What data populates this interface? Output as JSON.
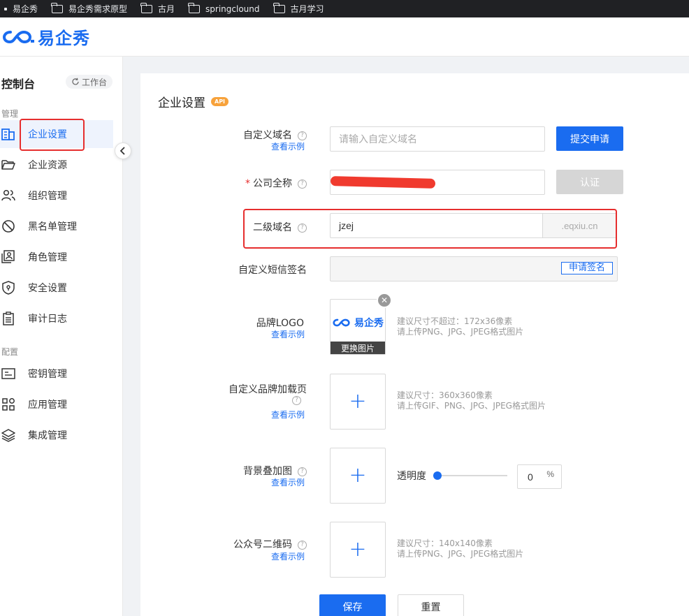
{
  "bookmarks": [
    {
      "label": "易企秀",
      "icon": "dot-icon"
    },
    {
      "label": "易企秀需求原型",
      "icon": "folder-icon"
    },
    {
      "label": "古月",
      "icon": "folder-icon"
    },
    {
      "label": "springclound",
      "icon": "folder-icon"
    },
    {
      "label": "古月学习",
      "icon": "folder-icon"
    }
  ],
  "header": {
    "logo_text": "易企秀"
  },
  "sidebar": {
    "title": "控制台",
    "workbench_label": "工作台",
    "groups": [
      {
        "label": "管理"
      },
      {
        "label": "配置"
      }
    ],
    "items": [
      {
        "label": "企业设置",
        "icon": "building-icon",
        "active": true
      },
      {
        "label": "企业资源",
        "icon": "folder-icon"
      },
      {
        "label": "组织管理",
        "icon": "users-icon"
      },
      {
        "label": "黑名单管理",
        "icon": "block-icon"
      },
      {
        "label": "角色管理",
        "icon": "role-icon"
      },
      {
        "label": "安全设置",
        "icon": "shield-icon"
      },
      {
        "label": "审计日志",
        "icon": "clipboard-icon"
      },
      {
        "label": "密钥管理",
        "icon": "key-card-icon"
      },
      {
        "label": "应用管理",
        "icon": "apps-icon"
      },
      {
        "label": "集成管理",
        "icon": "layers-icon"
      }
    ]
  },
  "main": {
    "title": "企业设置",
    "api_badge": "API",
    "example_link": "查看示例",
    "custom_domain": {
      "label": "自定义域名",
      "placeholder": "请输入自定义域名",
      "button": "提交申请"
    },
    "company_name": {
      "label": "公司全称",
      "required_mark": "*",
      "button": "认证"
    },
    "subdomain": {
      "label": "二级域名",
      "value": "jzej",
      "suffix": ".eqxiu.cn"
    },
    "sms_signature": {
      "label": "自定义短信签名",
      "button": "申请签名"
    },
    "brand_logo": {
      "label": "品牌LOGO",
      "replace_label": "更换图片",
      "logo_text": "易企秀",
      "hint_line1": "建议尺寸不超过：172x36像素",
      "hint_line2": "请上传PNG、JPG、JPEG格式图片"
    },
    "loading_page": {
      "label": "自定义品牌加载页",
      "hint_line1": "建议尺寸：360x360像素",
      "hint_line2": "请上传GIF、PNG、JPG、JPEG格式图片"
    },
    "background_overlay": {
      "label": "背景叠加图",
      "opacity_label": "透明度",
      "opacity_value": "0",
      "opacity_unit": "%",
      "opacity_fraction": 0
    },
    "qr_code": {
      "label": "公众号二维码",
      "hint_line1": "建议尺寸：140x140像素",
      "hint_line2": "请上传PNG、JPG、JPEG格式图片"
    },
    "save_button": "保存",
    "reset_button": "重置"
  },
  "colors": {
    "accent": "#1a6cf0",
    "highlight": "#e62e2e",
    "api_badge": "#f7a23b"
  }
}
